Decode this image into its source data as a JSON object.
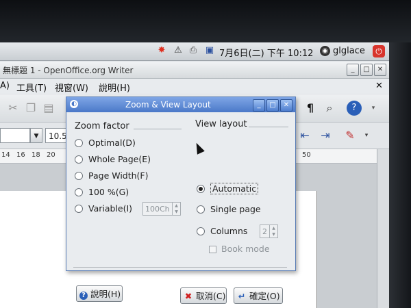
{
  "panel": {
    "clock": "7月6日(二) 下午 10:12",
    "user": "glglace",
    "tray_icons": [
      "alert-icon",
      "warning-icon",
      "printer-icon",
      "network-icon"
    ]
  },
  "window": {
    "title": "無標題 1 - OpenOffice.org Writer",
    "menu": [
      "A)",
      "工具(T)",
      "視窗(W)",
      "說明(H)"
    ]
  },
  "toolbar": {
    "font_size": "10.5",
    "ruler_labels": [
      "14",
      "16",
      "18",
      "20",
      "50"
    ]
  },
  "dialog": {
    "title": "Zoom & View Layout",
    "zoom_factor": {
      "title": "Zoom factor",
      "options": [
        "Optimal(D)",
        "Whole Page(E)",
        "Page Width(F)",
        "100 %(G)",
        "Variable(I)"
      ],
      "variable_value": "100Ch",
      "selected": null
    },
    "view_layout": {
      "title": "View layout",
      "options": [
        "Automatic",
        "Single page",
        "Columns"
      ],
      "selected": "Automatic",
      "columns_value": "2",
      "book_mode": "Book mode",
      "book_mode_checked": false
    },
    "buttons": {
      "help": "說明(H)",
      "cancel": "取消(C)",
      "ok": "確定(O)"
    }
  },
  "colors": {
    "dialog_title": "#4a78c8",
    "power_button": "#d8342c"
  }
}
